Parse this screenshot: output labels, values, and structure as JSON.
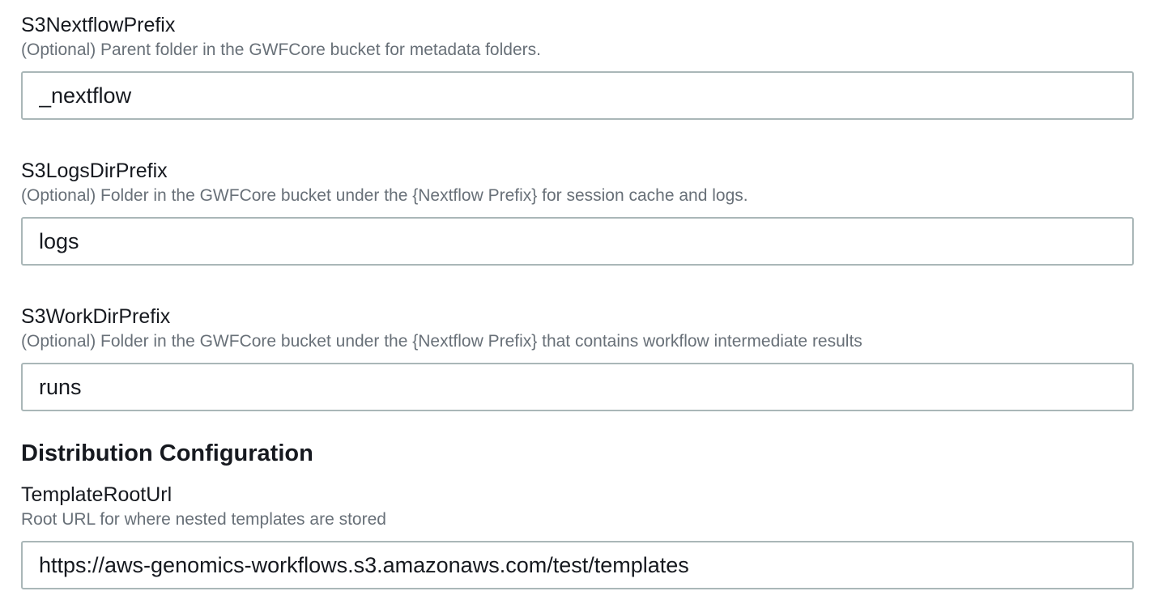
{
  "fields": [
    {
      "label": "S3NextflowPrefix",
      "description": "(Optional) Parent folder in the GWFCore bucket for metadata folders.",
      "value": "_nextflow"
    },
    {
      "label": "S3LogsDirPrefix",
      "description": "(Optional) Folder in the GWFCore bucket under the {Nextflow Prefix} for session cache and logs.",
      "value": "logs"
    },
    {
      "label": "S3WorkDirPrefix",
      "description": "(Optional) Folder in the GWFCore bucket under the {Nextflow Prefix} that contains workflow intermediate results",
      "value": "runs"
    }
  ],
  "distribution": {
    "heading": "Distribution Configuration",
    "field": {
      "label": "TemplateRootUrl",
      "description": "Root URL for where nested templates are stored",
      "value": "https://aws-genomics-workflows.s3.amazonaws.com/test/templates"
    }
  }
}
